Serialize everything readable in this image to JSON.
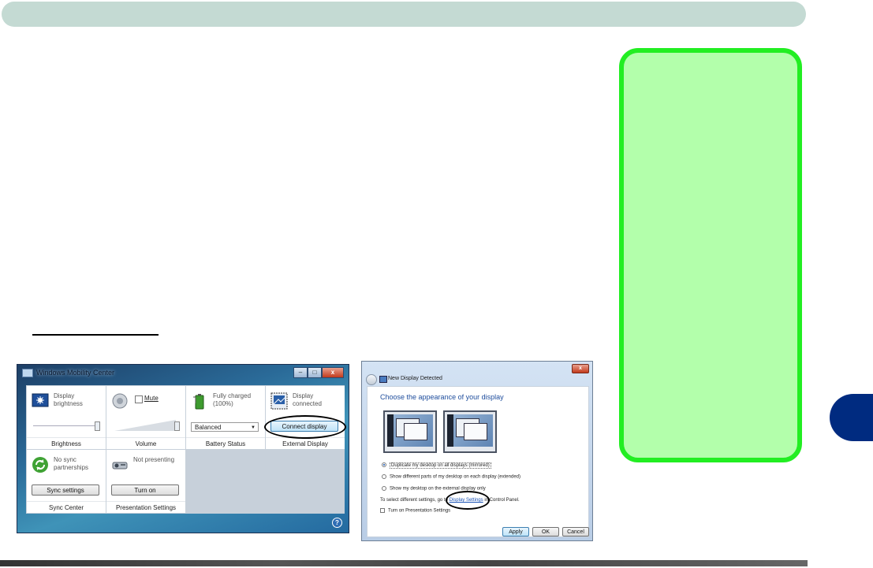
{
  "wmc": {
    "title": "Windows Mobility Center",
    "buttons": {
      "minimize": "–",
      "maximize": "□",
      "close": "x"
    },
    "brightness": {
      "text": "Display brightness",
      "label": "Brightness",
      "level_pct": 95
    },
    "volume": {
      "mute": "Mute",
      "label": "Volume",
      "level_pct": 95
    },
    "battery": {
      "text": "Fully charged (100%)",
      "plan": "Balanced",
      "label": "Battery Status"
    },
    "external_display": {
      "text": "Display connected",
      "button": "Connect display",
      "label": "External Display"
    },
    "sync": {
      "text": "No sync partnerships",
      "button": "Sync settings",
      "label": "Sync Center"
    },
    "presentation": {
      "text": "Not presenting",
      "button": "Turn on",
      "label": "Presentation Settings"
    },
    "help": "?"
  },
  "ndd": {
    "title": "New Display Detected",
    "close": "x",
    "heading": "Choose the appearance of your display",
    "options": [
      "Duplicate my desktop on all displays (mirrored)",
      "Show different parts of my desktop on each display (extended)",
      "Show my desktop on the external display only"
    ],
    "selected_option": 0,
    "settings_prefix": "To select different settings, go to",
    "settings_link": "Display Settings",
    "settings_suffix": "in Control Panel.",
    "presentation_checkbox": "Turn on Presentation Settings",
    "buttons": {
      "apply": "Apply",
      "ok": "OK",
      "cancel": "Cancel"
    }
  },
  "colors": {
    "header": "#c4dad3",
    "note_fill": "#b3ffab",
    "note_border": "#22ee22",
    "chapter_tab": "#002b80"
  }
}
